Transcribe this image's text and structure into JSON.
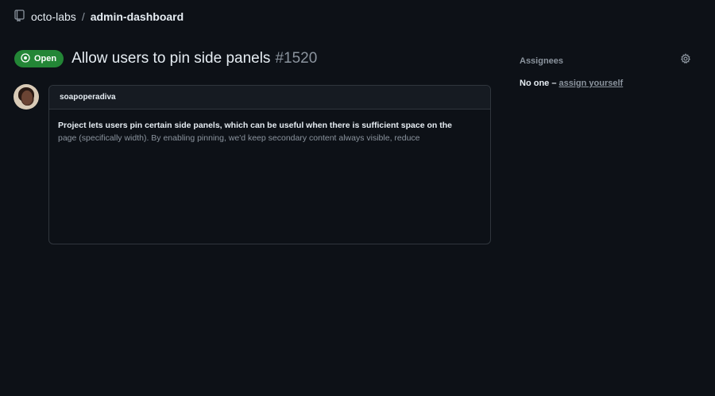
{
  "breadcrumb": {
    "owner": "octo-labs",
    "separator": "/",
    "repo": "admin-dashboard"
  },
  "issue": {
    "state_label": "Open",
    "title": "Allow users to pin side panels",
    "number": "#1520"
  },
  "comment": {
    "author": "soapoperadiva",
    "body_line1": "Project lets users pin certain side panels, which can be useful when there is sufficient space on the",
    "body_line2": "page (specifically width). By enabling pinning, we'd keep secondary content always visible, reduce"
  },
  "sidebar": {
    "assignees_title": "Assignees",
    "no_one": "No one –",
    "assign_yourself": "assign yourself"
  },
  "colors": {
    "background": "#0d1117",
    "open_badge": "#238636",
    "border": "#30363d",
    "muted_text": "#8b949e"
  },
  "icons": [
    "repo-icon",
    "issue-opened-icon",
    "gear-icon"
  ]
}
